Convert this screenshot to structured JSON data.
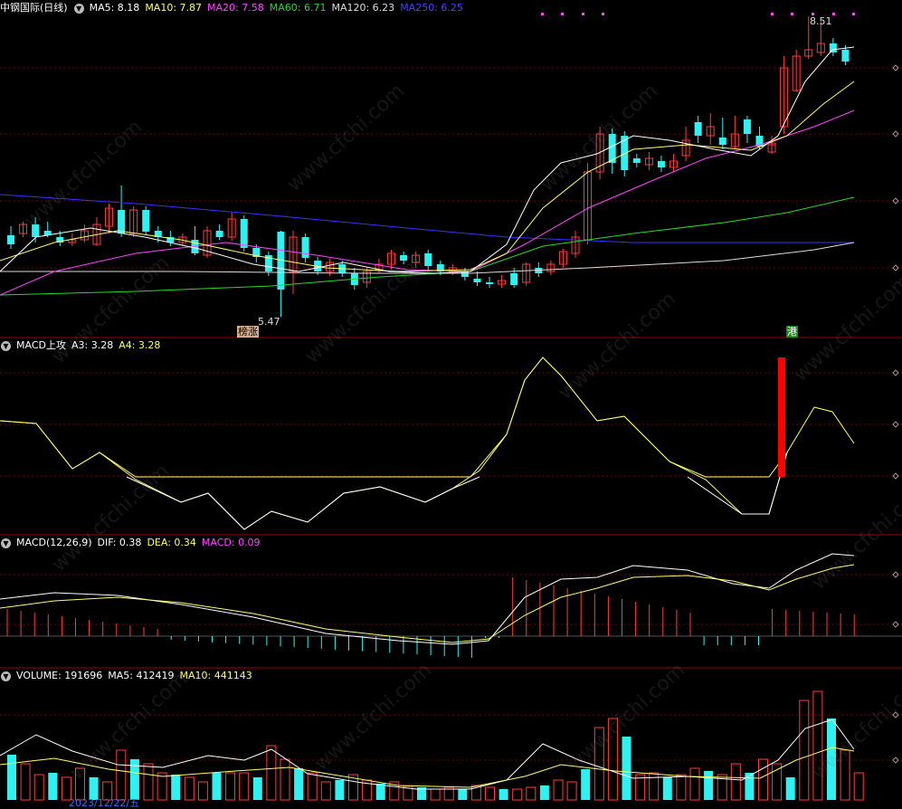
{
  "colors": {
    "up": "#ff3c3c",
    "down": "#2ef2f2",
    "grid": "#7a0000",
    "ma5": "#ffffff",
    "ma10": "#ffff66",
    "ma20": "#ff44ff",
    "ma60": "#22dd22",
    "ma120": "#dddddd",
    "ma250": "#3333ff",
    "dif": "#ffffff",
    "dea": "#ffff66",
    "macd_hist": "#ff44ff",
    "signal_bar": "#ff0000"
  },
  "main_header": {
    "title": "中钢国际(日线)",
    "ma5": "MA5: 8.18",
    "ma10": "MA10: 7.87",
    "ma20": "MA20: 7.58",
    "ma60": "MA60: 6.71",
    "ma120": "MA120: 6.23",
    "ma250": "MA250: 6.25"
  },
  "main_annotations": {
    "high_label": "8.51",
    "low_label": "5.47",
    "tag_left": "榜涨",
    "tag_right": "港"
  },
  "attack_header": {
    "name": "MACD上攻",
    "a3": "A3: 3.28",
    "a4": "A4: 3.28"
  },
  "macd_header": {
    "name": "MACD(12,26,9)",
    "dif": "DIF: 0.38",
    "dea": "DEA: 0.34",
    "macd": "MACD: 0.09"
  },
  "volume_header": {
    "name": "VOLUME: 191696",
    "ma5": "MA5: 412419",
    "ma10": "MA10: 441143"
  },
  "bottom_date": "2023/12/22/五",
  "watermark": "www.cfchi.com",
  "icons": {
    "collapse": "chevron-down-icon"
  }
}
